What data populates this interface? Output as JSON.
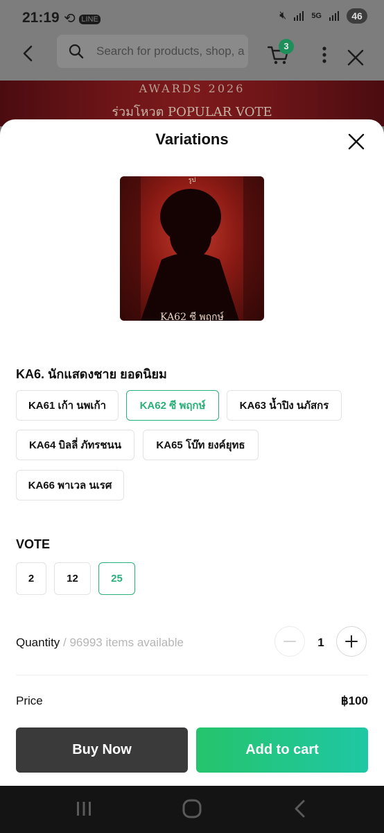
{
  "status_bar": {
    "time": "21:19",
    "battery": "46",
    "network": "5G",
    "icons": [
      "sync-icon",
      "line-app-icon",
      "mute-icon",
      "signal-icon",
      "signal-icon"
    ]
  },
  "header": {
    "search_placeholder": "Search for products, shop, a",
    "cart_count": "3",
    "icons": [
      "back-icon",
      "search-icon",
      "cart-icon",
      "more-icon",
      "close-icon"
    ]
  },
  "banner": {
    "line1": "AWARDS 2026",
    "line2": "ร่วมโหวต POPULAR VOTE"
  },
  "sheet": {
    "title": "Variations",
    "image_caption": "KA62 ซี พฤกษ์",
    "image_top_caption": "รูป",
    "option_group_1": {
      "label": "KA6. นักแสดงชาย ยอดนิยม",
      "options": [
        {
          "label": "KA61 เก้า นพเก้า",
          "selected": false
        },
        {
          "label": "KA62 ซี พฤกษ์",
          "selected": true
        },
        {
          "label": "KA63 น้ำปิง นภัสกร",
          "selected": false
        },
        {
          "label": "KA64 บิลลี่ ภัทรชนน",
          "selected": false
        },
        {
          "label": "KA65 โบ๊ท ยงค์ยุทธ",
          "selected": false
        },
        {
          "label": "KA66 พาเวล นเรศ",
          "selected": false
        }
      ]
    },
    "option_group_2": {
      "label": "VOTE",
      "options": [
        {
          "label": "2",
          "selected": false
        },
        {
          "label": "12",
          "selected": false
        },
        {
          "label": "25",
          "selected": true
        }
      ]
    },
    "quantity": {
      "label": "Quantity",
      "available": " / 96993 items available",
      "value": "1"
    },
    "price": {
      "label": "Price",
      "value": "฿100"
    },
    "buy_now_label": "Buy Now",
    "add_to_cart_label": "Add to cart"
  },
  "colors": {
    "accent_green": "#2bb07a",
    "buy_now_bg": "#3a3a3a",
    "add_to_cart_bg": "#25c46c"
  }
}
